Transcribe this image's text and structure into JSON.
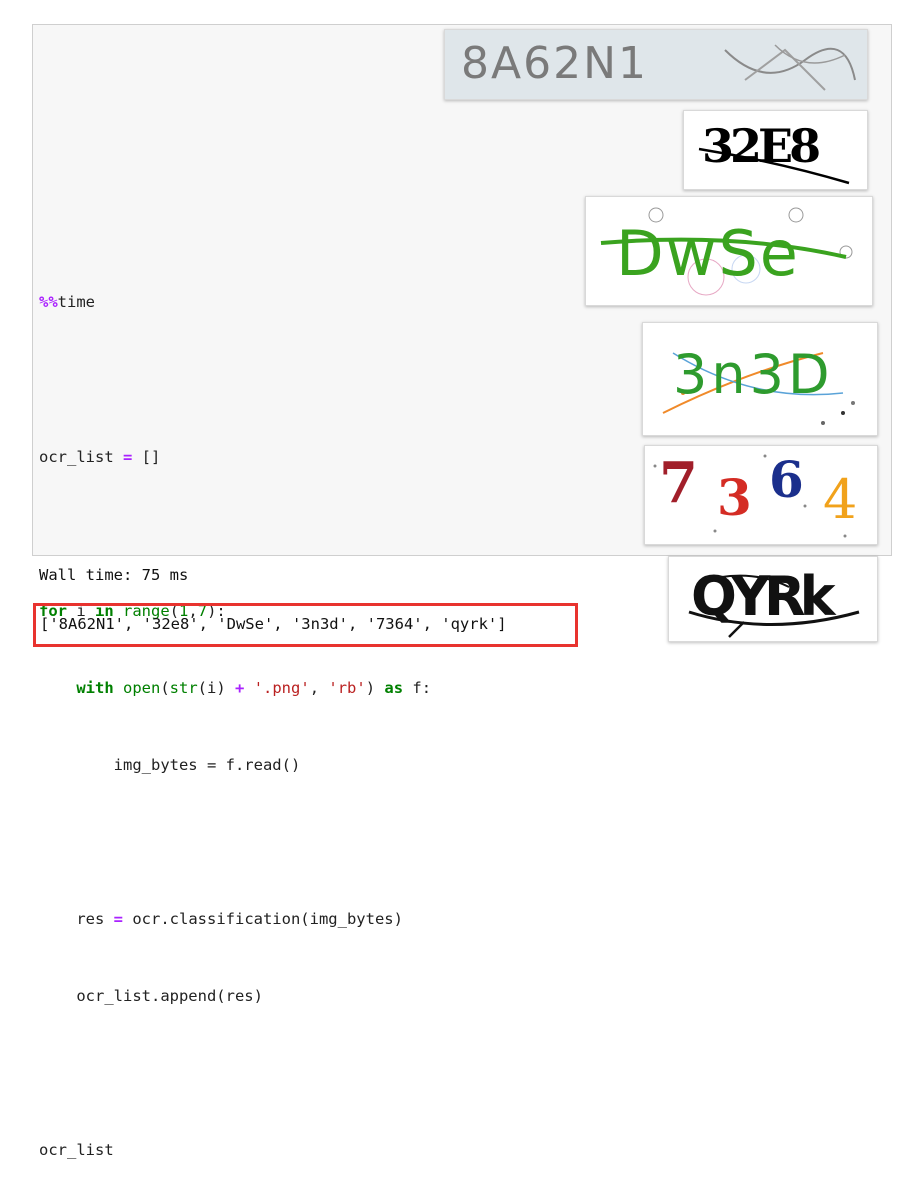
{
  "code_lines": [
    {
      "magic": "%%",
      "rest": "time"
    },
    {
      "text": ""
    },
    {
      "a": "ocr_list ",
      "op": "=",
      "b": " []"
    },
    {
      "text": ""
    },
    {
      "kw1": "for",
      "a": " i ",
      "kw2": "in",
      "sp": " ",
      "bi": "range",
      "b": "(",
      "n1": "1",
      "c": ",",
      "n2": "7",
      "d": "):"
    },
    {
      "indent": "    ",
      "kw1": "with",
      "sp": " ",
      "bi1": "open",
      "a": "(",
      "bi2": "str",
      "b": "(i) ",
      "op": "+",
      "sp2": " ",
      "s1": "'.png'",
      "c": ", ",
      "s2": "'rb'",
      "d": ") ",
      "kw2": "as",
      "e": " f:"
    },
    {
      "text": "        img_bytes = f.read()"
    },
    {
      "text": ""
    },
    {
      "a": "    res ",
      "op": "=",
      "b": " ocr.classification(img_bytes)"
    },
    {
      "text": "    ocr_list.append(res)"
    },
    {
      "text": ""
    },
    {
      "text": "ocr_list"
    }
  ],
  "output": {
    "wall_time": "Wall time: 75 ms",
    "result": "['8A62N1', '32e8', 'DwSe', '3n3d', '7364', 'qyrk']"
  },
  "captchas": [
    {
      "text": "8A62N1",
      "color": "#7a7a7a"
    },
    {
      "text": "32E8",
      "color": "#000000"
    },
    {
      "text": "DwSe",
      "color": "#3aa31f"
    },
    {
      "text": "3n3D",
      "color": "#2e9b2e"
    },
    {
      "digits": [
        "7",
        "3",
        "6",
        "4"
      ],
      "colors": [
        "#a11f2a",
        "#d42c24",
        "#1b2f8c",
        "#f1a21b"
      ]
    },
    {
      "text": "QYRk",
      "color": "#111111"
    }
  ]
}
